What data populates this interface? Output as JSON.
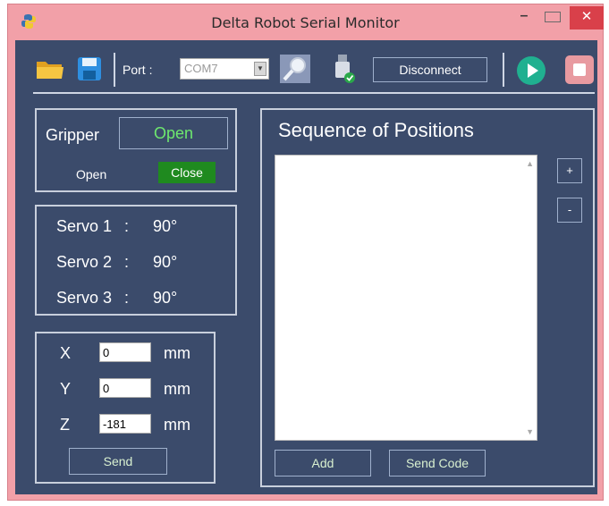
{
  "window": {
    "title": "Delta Robot Serial Monitor",
    "minimize_glyph": "–",
    "close_glyph": "✕"
  },
  "toolbar": {
    "port_label": "Port :",
    "port_value": "COM7",
    "disconnect_label": "Disconnect",
    "icons": [
      "folder-icon",
      "save-icon",
      "search-icon",
      "usb-connected-icon",
      "play-icon",
      "stop-icon"
    ]
  },
  "gripper": {
    "label": "Gripper",
    "open_button": "Open",
    "state_open": "Open",
    "state_close": "Close"
  },
  "servos": [
    {
      "label": "Servo 1",
      "value": "90°"
    },
    {
      "label": "Servo 2",
      "value": "90°"
    },
    {
      "label": "Servo 3",
      "value": "90°"
    }
  ],
  "servo_sep": ":",
  "coords": [
    {
      "axis": "X",
      "value": "0",
      "unit": "mm"
    },
    {
      "axis": "Y",
      "value": "0",
      "unit": "mm"
    },
    {
      "axis": "Z",
      "value": "-181",
      "unit": "mm"
    }
  ],
  "send_label": "Send",
  "sequence": {
    "title": "Sequence of Positions",
    "add_label": "Add",
    "send_code_label": "Send Code",
    "plus": "+",
    "minus": "-"
  },
  "colors": {
    "background": "#3b4b6b",
    "title_bar": "#f2a0a8",
    "close": "#d9404a",
    "active_close": "#1f8a1f",
    "play": "#20b090",
    "stop": "#e89aa0"
  }
}
